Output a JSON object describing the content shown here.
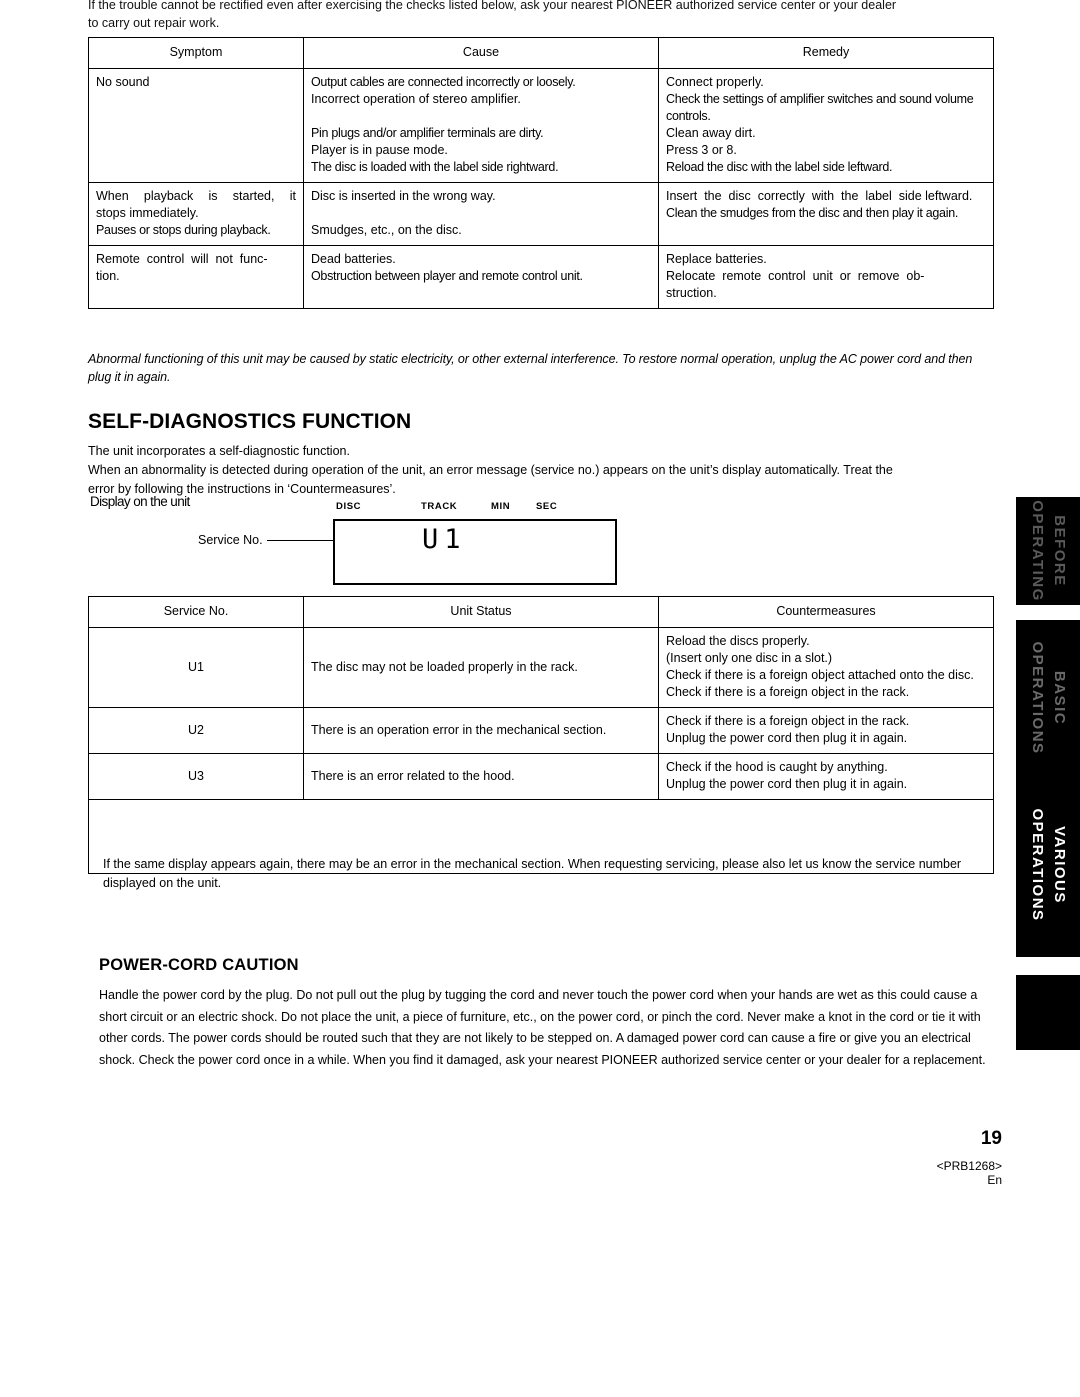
{
  "top_text": {
    "line1": "If the trouble cannot be rectified even after exercising the checks listed below, ask your nearest PIONEER authorized service center or your dealer",
    "line1_tail": "center or your dealer",
    "line2": "to carry out repair work."
  },
  "trouble_table": {
    "headers": [
      "Symptom",
      "Cause",
      "Remedy"
    ],
    "rows": [
      {
        "symptom": "No sound",
        "pairs": [
          {
            "cause": "Output cables are connected incorrectly or loosely.",
            "remedy": "Connect properly."
          },
          {
            "cause": "Incorrect operation of stereo amplifier.",
            "remedy": "Check the settings of amplifier switches and sound volume controls."
          },
          {
            "cause": "Pin plugs and/or amplifier terminals are dirty.",
            "remedy": "Clean away dirt."
          },
          {
            "cause": "Player is in pause mode.",
            "remedy": "Press 3 or 8."
          },
          {
            "cause": "The disc is loaded with the label side rightward.",
            "remedy": "Reload the disc with the label side leftward."
          }
        ]
      },
      {
        "symptom": "When playback is started, it stops immediately.\nPauses or stops during playback.",
        "pairs": [
          {
            "cause": "Disc is inserted in the wrong way.",
            "remedy": "Insert the disc correctly with the label side leftward."
          },
          {
            "cause": "Smudges, etc., on the disc.",
            "remedy": "Clean the smudges from the disc and then play it again."
          }
        ]
      },
      {
        "symptom": "Remote control will not function.",
        "pairs": [
          {
            "cause": "Dead batteries.",
            "remedy": "Replace batteries."
          },
          {
            "cause": "Obstruction between player and remote control unit.",
            "remedy": "Relocate remote control unit or remove obstruction."
          }
        ]
      }
    ]
  },
  "abnormal_note": "Abnormal functioning of this unit may be caused by static electricity, or other external interference. To restore normal operation, unplug the AC power cord and then plug it in again.",
  "self_diagnostics": {
    "heading": "SELF-DIAGNOSTICS FUNCTION",
    "para1": "The unit incorporates a self-diagnostic function.",
    "para2": "When an abnormality is detected during operation of the unit, an error message (service no.) appears on the unit’s display automatically. Treat the",
    "para3": "error by following the instructions in ‘Countermeasures’.",
    "subheading": "Display on the unit",
    "display": {
      "labels": [
        "DISC",
        "TRACK",
        "MIN",
        "SEC"
      ],
      "service_no_label": "Service No.",
      "readout": "U1"
    }
  },
  "service_table": {
    "headers": [
      "Service No.",
      "Unit Status",
      "Countermeasures"
    ],
    "rows": [
      {
        "no": "U1",
        "status": "The disc may not be loaded properly in the rack.",
        "measures": [
          "Reload the discs properly.",
          "(Insert only one disc in a slot.)",
          "Check if there is a foreign object attached onto the disc.",
          "Check if there is a foreign object in the rack."
        ]
      },
      {
        "no": "U2",
        "status": "There is an operation error in the mechanical section.",
        "measures": [
          "Check if there is a foreign object in the rack.",
          "Unplug the power cord then plug it in again."
        ]
      },
      {
        "no": "U3",
        "status": "There is an error related to the hood.",
        "measures": [
          "Check if the hood is caught by anything.",
          "Unplug the power cord then plug it in again."
        ]
      }
    ],
    "note": "If the same display appears again, there may be an error in the mechanical section. When requesting servicing, please also let us know the service number displayed on the unit."
  },
  "power_cord": {
    "heading": "POWER-CORD CAUTION",
    "body": "Handle the power cord by the plug. Do not pull out the plug by tugging the cord and never touch the power cord when your hands are wet as this could cause a short circuit or an electric shock. Do not place the unit, a piece of furniture, etc., on the power cord, or pinch the cord. Never make a knot in the cord or tie it with other cords. The power cords should be routed such that they are not likely to be stepped on. A damaged power cord can cause a fire or give you an electrical shock. Check the power cord once in a while. When you find it damaged, ask your nearest PIONEER authorized service center or your dealer for a replacement."
  },
  "side_tabs": [
    {
      "line1": "BEFORE",
      "line2": "OPERATING"
    },
    {
      "line1": "BASIC",
      "line2": "OPERATIONS"
    },
    {
      "line1": "VARIOUS",
      "line2": "OPERATIONS"
    }
  ],
  "footer": {
    "page_number": "19",
    "code": "<PRB1268>",
    "lang": "En"
  }
}
